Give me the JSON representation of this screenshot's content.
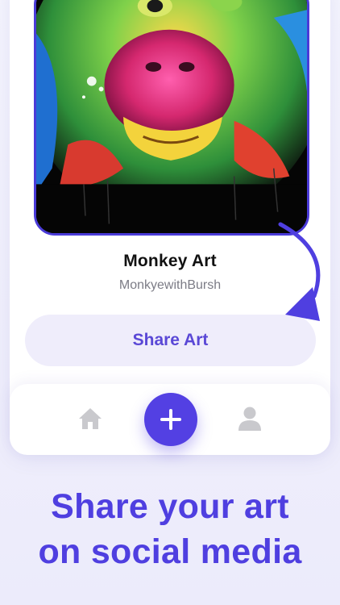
{
  "artwork": {
    "title": "Monkey Art",
    "author": "MonkyewithBursh",
    "icon": "monkey-artwork-image"
  },
  "actions": {
    "share_label": "Share Art"
  },
  "nav": {
    "items": [
      {
        "name": "home",
        "icon": "home-icon"
      },
      {
        "name": "add",
        "icon": "plus-icon"
      },
      {
        "name": "profile",
        "icon": "person-icon"
      }
    ]
  },
  "promo": {
    "line1": "Share your art",
    "line2": "on social media"
  },
  "colors": {
    "accent": "#4f3fe0",
    "button_bg": "#efedfb",
    "background": "#f0effc"
  }
}
